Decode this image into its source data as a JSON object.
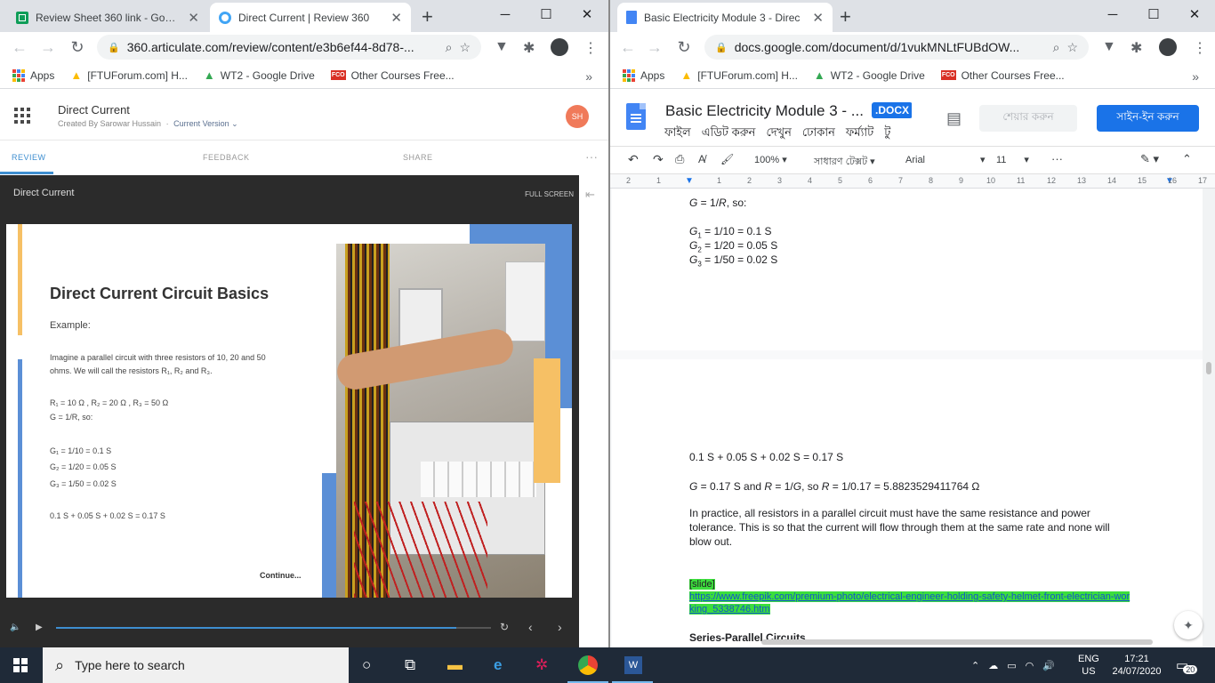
{
  "left_window": {
    "tabs": [
      {
        "title": "Review Sheet 360 link - Google",
        "icon": "sheets-icon",
        "active": false
      },
      {
        "title": "Direct Current | Review 360",
        "icon": "review360-icon",
        "active": true
      }
    ],
    "url": "360.articulate.com/review/content/e3b6ef44-8d78-...",
    "bookmarks": {
      "apps": "Apps",
      "b1": "[FTUForum.com] H...",
      "b2": "WT2 - Google Drive",
      "b3": "Other Courses Free...",
      "more": "»"
    },
    "review": {
      "title": "Direct Current",
      "created_by": "Created By Sarowar Hussain",
      "separator": "·",
      "version": "Current Version ⌄",
      "avatar_initials": "SH",
      "tabs": {
        "review": "REVIEW",
        "feedback": "FEEDBACK",
        "share": "SHARE",
        "more": "···"
      },
      "player_title": "Direct Current",
      "full_screen": "FULL SCREEN",
      "collapse": "⇤",
      "progress": 0.92,
      "slide": {
        "heading": "Direct Current Circuit Basics",
        "example": "Example:",
        "body1": "Imagine a parallel circuit with three resistors of 10, 20 and 50",
        "body2": "ohms. We will call the resistors R₁, R₂ and R₃.",
        "r_values": "R₁ = 10 Ω , R₂ = 20 Ω , R₃ = 50 Ω",
        "g_def": "G = 1/R, so:",
        "g1": "G₁ = 1/10 = 0.1 S",
        "g2": "G₂ = 1/20 = 0.05 S",
        "g3": "G₃ = 1/50 = 0.02 S",
        "sum": "0.1 S + 0.05 S + 0.02 S = 0.17 S",
        "continue": "Continue..."
      }
    }
  },
  "right_window": {
    "tabs": [
      {
        "title": "Basic Electricity Module 3 - Direc",
        "icon": "docs-icon",
        "active": true
      }
    ],
    "url": "docs.google.com/document/d/1vukMNLtFUBdOW...",
    "bookmarks": {
      "apps": "Apps",
      "b1": "[FTUForum.com] H...",
      "b2": "WT2 - Google Drive",
      "b3": "Other Courses Free...",
      "more": "»"
    },
    "doc_title": "Basic Electricity Module 3 - ...",
    "doc_badge": ".DOCX",
    "menus": [
      "ফাইল",
      "এডিট করুন",
      "দেখুন",
      "ঢোকান",
      "ফর্ম্যাট",
      "টু"
    ],
    "share_label": "শেয়ার করুন",
    "signin_label": "সাইন-ইন করুন",
    "toolbar": {
      "zoom": "100%",
      "style": "সাধারণ টেক্সট",
      "font": "Arial",
      "size": "11",
      "more": "···"
    },
    "ruler": [
      "2",
      "1",
      "1",
      "2",
      "3",
      "4",
      "5",
      "6",
      "7",
      "8",
      "9",
      "10",
      "11",
      "12",
      "13",
      "14",
      "15",
      "16",
      "17"
    ],
    "page1": {
      "g_def_a": "G",
      "g_def_b": " = 1/",
      "g_def_c": "R",
      "g_def_d": ", so:",
      "g1_a": "G",
      "g1_sub": "1",
      "g1_b": " = 1/10 = 0.1 S",
      "g2_a": "G",
      "g2_sub": "2",
      "g2_b": " = 1/20 = 0.05 S",
      "g3_a": "G",
      "g3_sub": "3",
      "g3_b": " = 1/50 = 0.02 S"
    },
    "page2": {
      "sum": "0.1 S + 0.05 S + 0.02 S = 0.17 S",
      "r_a": "G",
      "r_b": " = 0.17 S and ",
      "r_c": "R",
      "r_d": " = 1/",
      "r_e": "G",
      "r_f": ", so ",
      "r_g": "R",
      "r_h": " = 1/0.17 =  5.8823529411764 Ω",
      "para_l1": "In practice, all resistors in a parallel circuit must have the same resistance and power",
      "para_l2": "tolerance. This is so that the current will flow through them at the same rate and none will",
      "para_l3": "blow out.",
      "slide_tag": "[slide]",
      "link_l1": "https://www.freepik.com/premium-photo/electrical-engineer-holding-safety-helmet-front-electrician-wor",
      "link_l2": "king_5338746.htm",
      "next_heading": "Series-Parallel Circuits"
    }
  },
  "taskbar": {
    "search_placeholder": "Type here to search",
    "lang1": "ENG",
    "lang2": "US",
    "time": "17:21",
    "date": "24/07/2020",
    "notifications": "20"
  },
  "colors": {
    "accent_blue": "#1a73e8",
    "articulate_blue": "#3e8ed0",
    "avatar": "#f07a5a",
    "highlight": "#3cde3c",
    "taskbar": "#1f2a38"
  }
}
